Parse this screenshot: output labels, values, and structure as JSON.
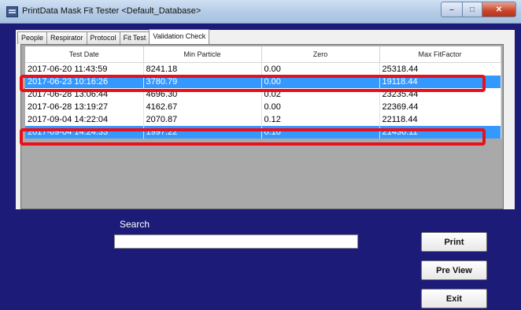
{
  "window": {
    "title": "PrintData Mask Fit Tester <Default_Database>"
  },
  "tabs": [
    {
      "label": "People"
    },
    {
      "label": "Respirator"
    },
    {
      "label": "Protocol"
    },
    {
      "label": "Fit Test"
    },
    {
      "label": "Validation Check"
    }
  ],
  "active_tab": "Validation Check",
  "grid": {
    "columns": [
      "Test Date",
      "Min Particle",
      "Zero",
      "Max FitFactor"
    ],
    "rows": [
      {
        "date": "2017-06-20 11:43:59",
        "min": "8241.18",
        "zero": "0.00",
        "max": "25318.44"
      },
      {
        "date": "2017-06-23 10:16:26",
        "min": "3780.79",
        "zero": "0.00",
        "max": "19118.44"
      },
      {
        "date": "2017-06-28 13:06:44",
        "min": "4696.30",
        "zero": "0.02",
        "max": "23235.44"
      },
      {
        "date": "2017-06-28 13:19:27",
        "min": "4162.67",
        "zero": "0.00",
        "max": "22369.44"
      },
      {
        "date": "2017-09-04 14:22:04",
        "min": "2070.87",
        "zero": "0.12",
        "max": "22118.44"
      },
      {
        "date": "2017-09-04 14:24:33",
        "min": "1997.22",
        "zero": "0.10",
        "max": "21436.11"
      }
    ]
  },
  "search": {
    "label": "Search",
    "value": ""
  },
  "buttons": {
    "print": "Print",
    "preview": "Pre View",
    "exit": "Exit"
  },
  "colors": {
    "background": "#1c1c78",
    "selection": "#3399ff",
    "highlight_box": "#e8101c"
  }
}
